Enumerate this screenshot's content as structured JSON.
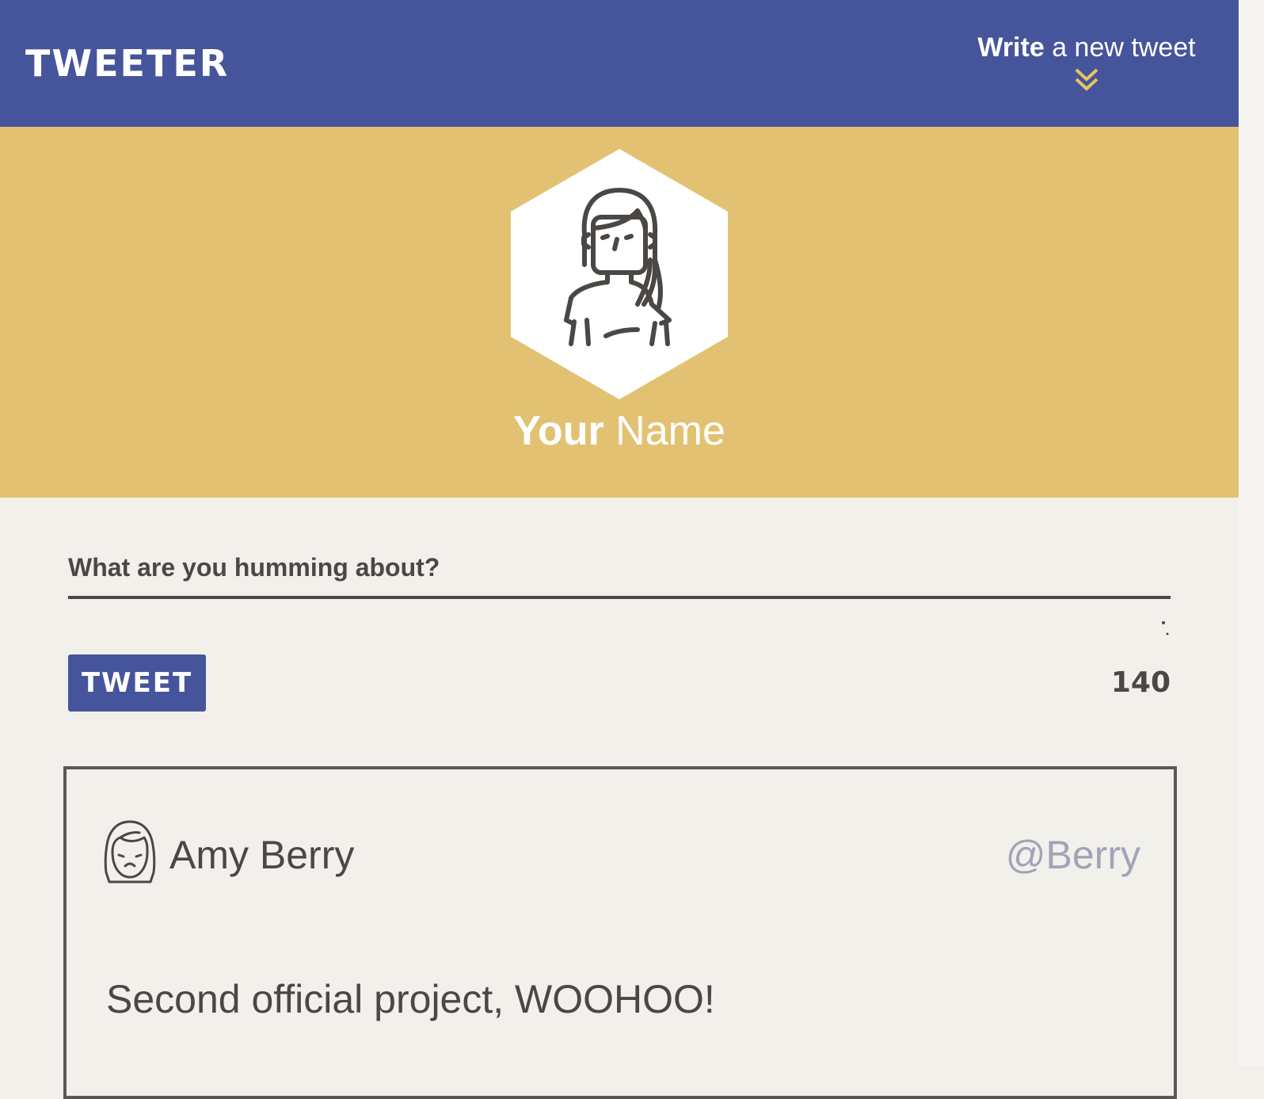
{
  "nav": {
    "logo": "TWEETER",
    "compose_toggle": {
      "bold": "Write",
      "rest": "a new tweet",
      "icon": "double-chevron-down-icon",
      "icon_color": "#e7c45f"
    }
  },
  "profile": {
    "avatar_icon": "woman-avatar-icon",
    "name_first": "Your",
    "name_last": "Name"
  },
  "composer": {
    "placeholder": "What are you humming about?",
    "value": "",
    "tweet_button": "TWEET",
    "char_count": "140"
  },
  "tweets": [
    {
      "avatar_icon": "girl-avatar-icon",
      "author": "Amy Berry",
      "handle": "@Berry",
      "text": "Second official project, WOOHOO!"
    }
  ],
  "colors": {
    "nav_bg": "#46559b",
    "profile_bg": "#e2c272",
    "page_bg": "#f2f0eb",
    "text_dark": "#4a4744",
    "handle": "#a3a2b8"
  }
}
